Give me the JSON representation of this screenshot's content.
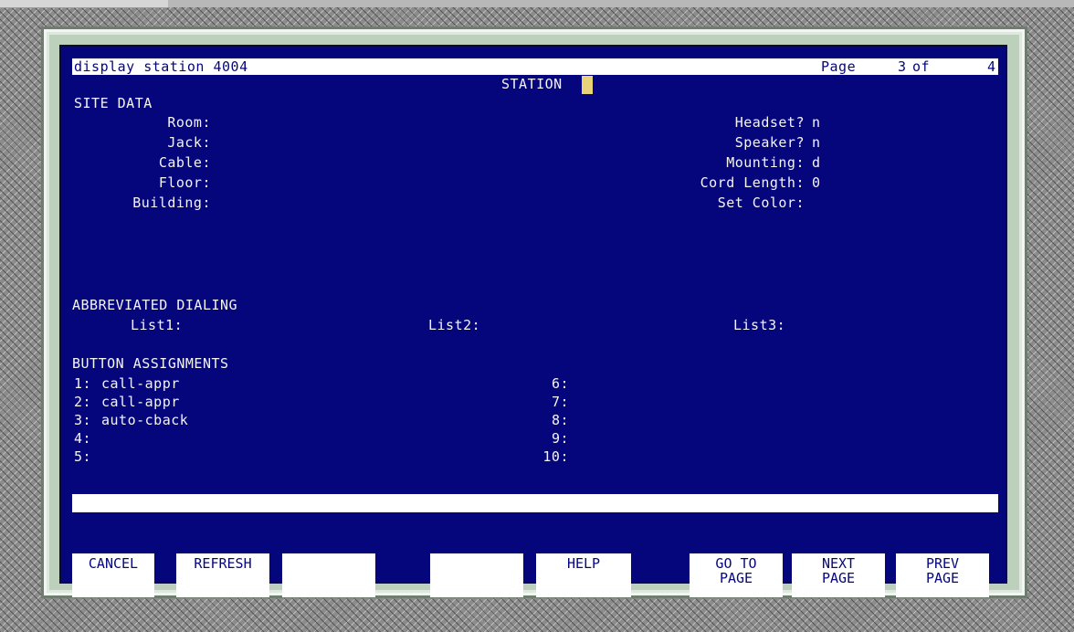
{
  "header": {
    "command": "display station 4004",
    "page_label": "Page",
    "page_current": "3",
    "page_of": "of",
    "page_total": "4"
  },
  "form_title": "STATION",
  "site_data": {
    "section_title": "SITE DATA",
    "left_fields": [
      {
        "label": "Room:",
        "value": ""
      },
      {
        "label": "Jack:",
        "value": ""
      },
      {
        "label": "Cable:",
        "value": ""
      },
      {
        "label": "Floor:",
        "value": ""
      },
      {
        "label": "Building:",
        "value": ""
      }
    ],
    "right_fields": [
      {
        "label": "Headset?",
        "value": "n"
      },
      {
        "label": "Speaker?",
        "value": "n"
      },
      {
        "label": "Mounting:",
        "value": "d"
      },
      {
        "label": "Cord Length:",
        "value": "0"
      },
      {
        "label": "Set Color:",
        "value": ""
      }
    ]
  },
  "abbreviated_dialing": {
    "section_title": "ABBREVIATED DIALING",
    "lists": [
      {
        "label": "List1:",
        "value": ""
      },
      {
        "label": "List2:",
        "value": ""
      },
      {
        "label": "List3:",
        "value": ""
      }
    ]
  },
  "button_assignments": {
    "section_title": "BUTTON ASSIGNMENTS",
    "left": [
      {
        "num": "1:",
        "value": "call-appr"
      },
      {
        "num": "2:",
        "value": "call-appr"
      },
      {
        "num": "3:",
        "value": "auto-cback"
      },
      {
        "num": "4:",
        "value": ""
      },
      {
        "num": "5:",
        "value": ""
      }
    ],
    "right": [
      {
        "num": "6:",
        "value": ""
      },
      {
        "num": "7:",
        "value": ""
      },
      {
        "num": "8:",
        "value": ""
      },
      {
        "num": "9:",
        "value": ""
      },
      {
        "num": "10:",
        "value": ""
      }
    ]
  },
  "message_line": "",
  "function_keys": [
    {
      "label": "CANCEL"
    },
    {
      "label": "REFRESH"
    },
    {
      "label": ""
    },
    {
      "label": ""
    },
    {
      "label": "HELP"
    },
    {
      "label": "GO TO\nPAGE"
    },
    {
      "label": "NEXT\nPAGE"
    },
    {
      "label": "PREV\nPAGE"
    }
  ],
  "colors": {
    "screen_bg": "#06067c",
    "text": "#f4f4f4",
    "cursor": "#e8d27a",
    "frame": "#bcd0bc"
  }
}
